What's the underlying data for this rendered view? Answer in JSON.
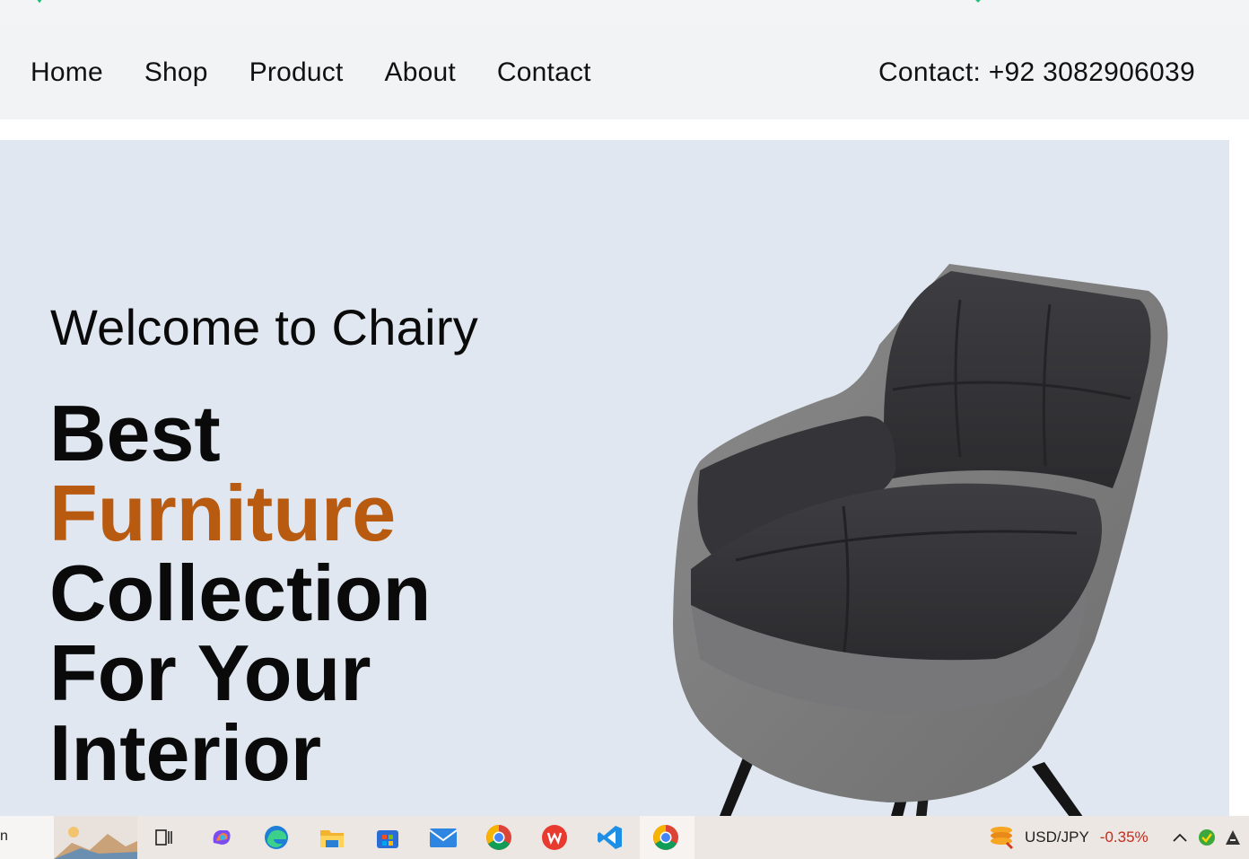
{
  "nav": {
    "items": [
      {
        "label": "Home"
      },
      {
        "label": "Shop"
      },
      {
        "label": "Product"
      },
      {
        "label": "About"
      },
      {
        "label": "Contact"
      }
    ],
    "contact": "Contact: +92 3082906039"
  },
  "hero": {
    "welcome": "Welcome to Chairy",
    "headline": {
      "line1": "Best",
      "line2": "Furniture",
      "line3": "Collection",
      "line4": "For Your",
      "line5": "Interior"
    },
    "accent_color": "#b85a10",
    "background_color": "#e0e7f0"
  },
  "taskbar": {
    "search_fragment": "n",
    "apps": [
      "widgets-icon",
      "task-view-icon",
      "copilot-icon",
      "edge-icon",
      "file-explorer-icon",
      "store-icon",
      "mail-icon",
      "chrome-icon",
      "wps-icon",
      "vscode-icon",
      "chrome-icon"
    ],
    "ticker": {
      "pair": "USD/JPY",
      "change": "-0.35%"
    }
  }
}
